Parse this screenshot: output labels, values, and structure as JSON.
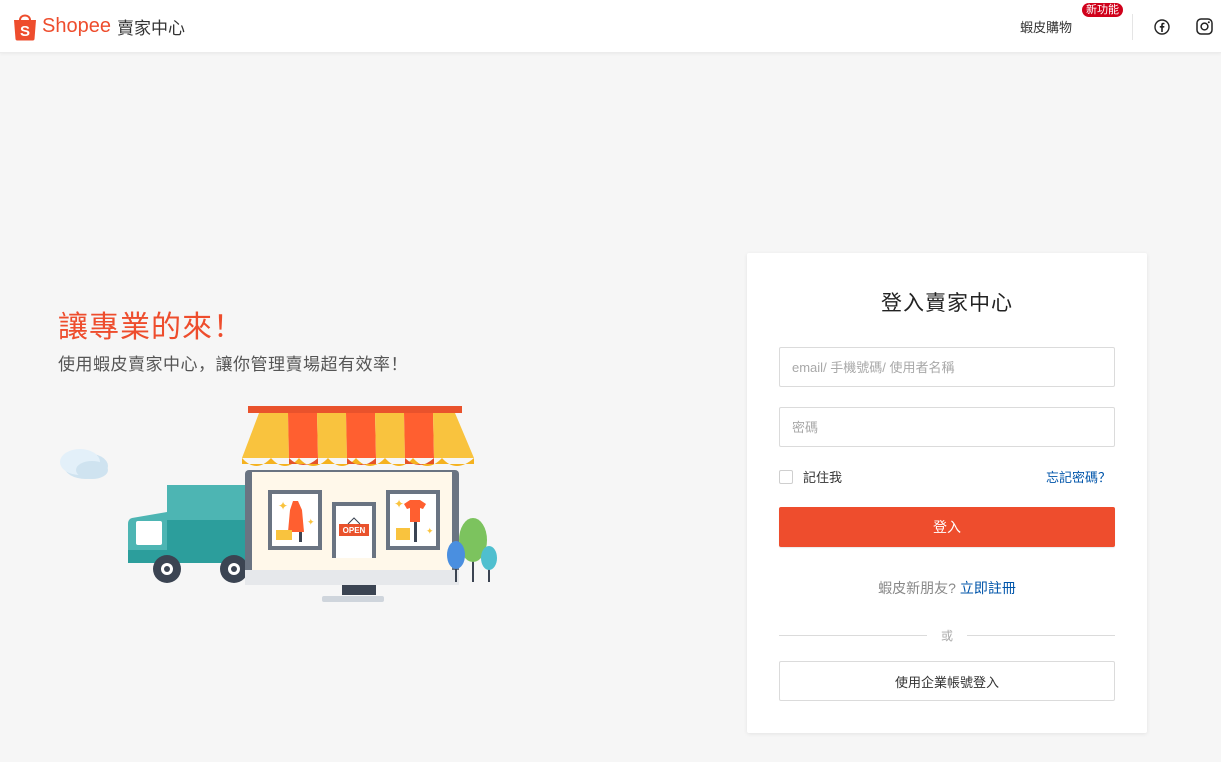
{
  "header": {
    "brand": "Shopee",
    "subtitle": "賣家中心",
    "shop_link": "蝦皮購物",
    "new_badge": "新功能"
  },
  "hero": {
    "title": "讓專業的來！",
    "subtitle": "使用蝦皮賣家中心，讓你管理賣場超有效率！",
    "illustration_sign": "OPEN"
  },
  "login": {
    "title": "登入賣家中心",
    "username_placeholder": "email/ 手機號碼/ 使用者名稱",
    "password_placeholder": "密碼",
    "remember_label": "記住我",
    "forgot_label": "忘記密碼？",
    "submit_label": "登入",
    "signup_prompt": "蝦皮新朋友?",
    "signup_link": "立即註冊",
    "or_label": "或",
    "enterprise_label": "使用企業帳號登入"
  },
  "colors": {
    "brand": "#ee4d2d",
    "link": "#0055aa",
    "badge": "#d0011b"
  },
  "icons": [
    "shopee-bag-icon",
    "facebook-icon",
    "instagram-icon"
  ]
}
